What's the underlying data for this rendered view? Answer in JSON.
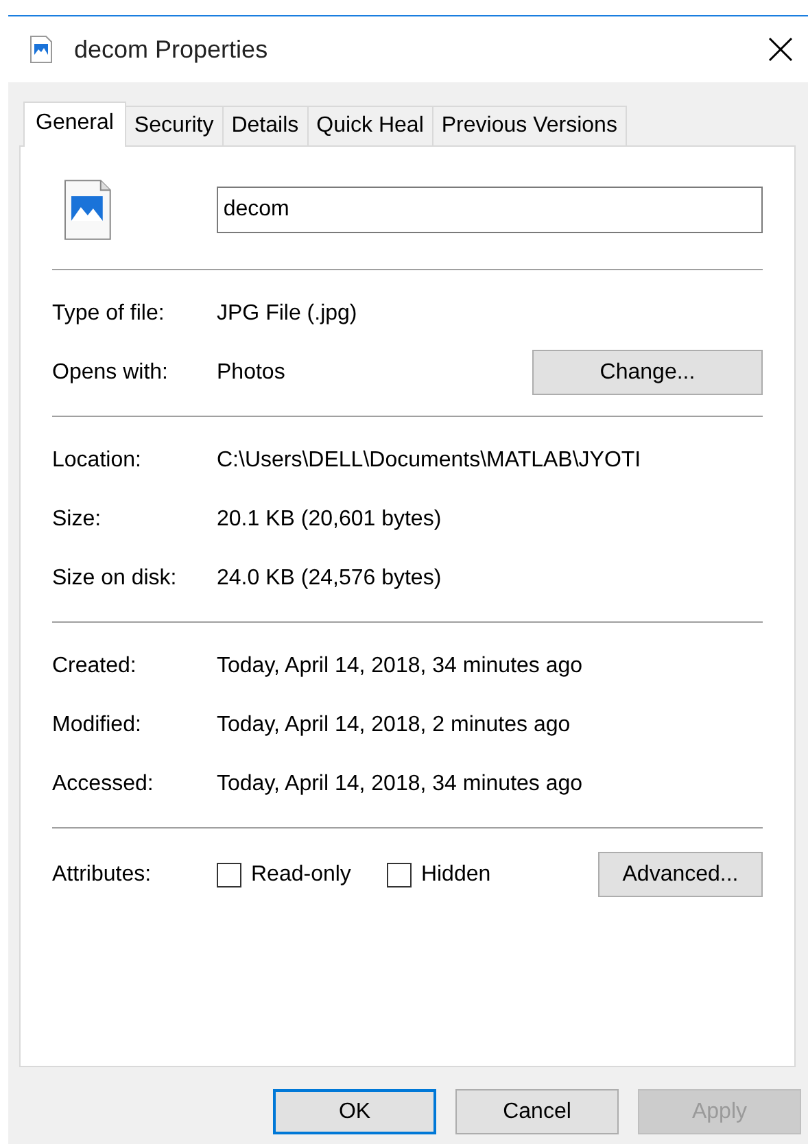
{
  "window": {
    "title": "decom Properties"
  },
  "tabs": [
    {
      "label": "General",
      "selected": true
    },
    {
      "label": "Security",
      "selected": false
    },
    {
      "label": "Details",
      "selected": false
    },
    {
      "label": "Quick Heal",
      "selected": false
    },
    {
      "label": "Previous Versions",
      "selected": false
    }
  ],
  "file_name": "decom",
  "sections": [
    {
      "rows": [
        {
          "label": "Type of file:",
          "value": "JPG File (.jpg)"
        },
        {
          "label": "Opens with:",
          "value": "Photos",
          "button": "Change..."
        }
      ]
    },
    {
      "rows": [
        {
          "label": "Location:",
          "value": "C:\\Users\\DELL\\Documents\\MATLAB\\JYOTI"
        },
        {
          "label": "Size:",
          "value": "20.1 KB (20,601 bytes)"
        },
        {
          "label": "Size on disk:",
          "value": "24.0 KB (24,576 bytes)"
        }
      ]
    },
    {
      "rows": [
        {
          "label": "Created:",
          "value": "Today, April 14, 2018, 34 minutes ago"
        },
        {
          "label": "Modified:",
          "value": "Today, April 14, 2018, 2 minutes ago"
        },
        {
          "label": "Accessed:",
          "value": "Today, April 14, 2018, 34 minutes ago"
        }
      ]
    }
  ],
  "attributes": {
    "label": "Attributes:",
    "checkboxes": [
      {
        "label": "Read-only",
        "checked": false
      },
      {
        "label": "Hidden",
        "checked": false
      }
    ],
    "button": "Advanced..."
  },
  "buttons": [
    {
      "label": "OK",
      "default": true,
      "disabled": false
    },
    {
      "label": "Cancel",
      "default": false,
      "disabled": false
    },
    {
      "label": "Apply",
      "default": false,
      "disabled": true
    }
  ]
}
